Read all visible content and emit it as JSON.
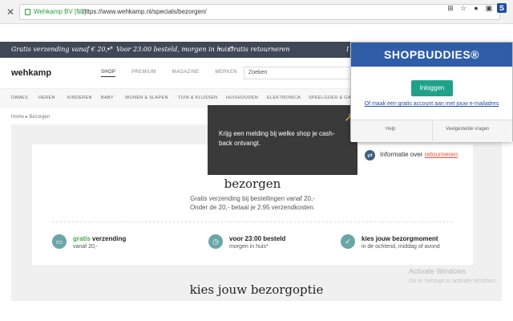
{
  "browser": {
    "close_glyph": "✕",
    "secure_label": "Wehkamp BV [NL]",
    "url_separator": "|",
    "url": "https://www.wehkamp.nl/specials/bezorgen/",
    "extension_icons": [
      "translate-icon",
      "star-icon",
      "extension-icon",
      "extension-icon",
      "shopbuddies-icon"
    ]
  },
  "promo": {
    "item1": "Gratis verzending vanaf € 20,-*",
    "bullet1": "•",
    "item2": "Voor 23:00 besteld, morgen in huis*",
    "bullet2": "•",
    "item3": "Gratis retourneren",
    "item4": "I"
  },
  "header": {
    "logo": "wehkamp",
    "nav": [
      "SHOP",
      "PREMIUM",
      "MAGAZINE",
      "MERKEN"
    ],
    "search_placeholder": "Zoeken"
  },
  "categories": [
    "DAMES",
    "HEREN",
    "KINDEREN",
    "BABY",
    "WONEN & SLAPEN",
    "TUIN & KLUSSEN",
    "HUISHOUDEN",
    "ELEKTRONICA",
    "SPEELGOED & GA"
  ],
  "breadcrumb": {
    "home": "Home",
    "arrow": "▸",
    "current": "Bezorgen"
  },
  "main": {
    "title": "bezorgen",
    "sub1": "Gratis verzending bij bestellingen vanaf 20,-",
    "sub2": "Onder de 20,- betaal je 2.95 verzendkosten.",
    "retour_prefix": "Informatie over",
    "retour_link": "retourneren",
    "features": [
      {
        "green": "gratis",
        "title": "verzending",
        "sub": "vanaf 20,-"
      },
      {
        "title": "voor 23:00 besteld",
        "sub": "morgen in huis*"
      },
      {
        "title": "kies jouw bezorgmoment",
        "sub": "in de ochtend, middag of avond"
      }
    ],
    "bottom_title": "kies jouw bezorgoptie"
  },
  "watermark": {
    "line1": "Activate Windows",
    "line2": "Go to Settings to activate Windows."
  },
  "tooltip": {
    "text": "Krijg een melding bij welke shop je cash-back ontvangt.",
    "arrow": "↗"
  },
  "popup": {
    "logo": "SHOPBUDDIES®",
    "login": "Inloggen",
    "signup": "Of maak een gratis account aan met jouw e-mailadres",
    "help": "Help",
    "faq": "Veelgestelde vragen"
  },
  "colors": {
    "promo_bg": "#3f4856",
    "popup_brand": "#2f5da8",
    "login_btn": "#20a28a",
    "accent_link": "#e2533e"
  }
}
